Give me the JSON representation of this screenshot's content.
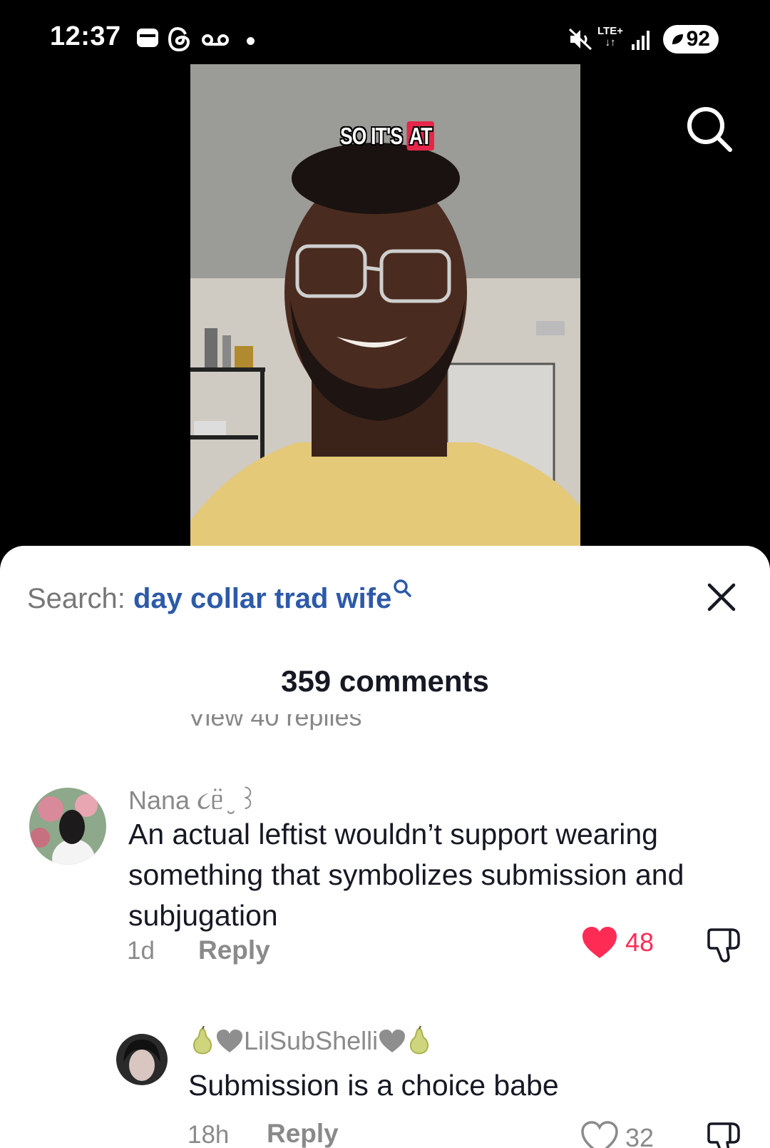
{
  "status_bar": {
    "time": "12:37",
    "icons": [
      "message-icon",
      "threads-icon",
      "voicemail-icon",
      "dot-icon",
      "mute-icon",
      "signal-icon"
    ],
    "network": "LTE+",
    "battery": "92"
  },
  "video": {
    "caption_prefix": "SO IT'S",
    "caption_highlight": "AT",
    "accent_color": "#e5264a"
  },
  "sheet": {
    "search_label": "Search:",
    "search_query": "day collar trad wife",
    "comments_count": "359 comments",
    "view_replies": "View 40 replies"
  },
  "comments": [
    {
      "username": "Nana ૮ᥱ̈ ̮ ꒱",
      "text": "An actual leftist wouldn’t support wearing something that symbolizes submission and subjugation",
      "age": "1d",
      "reply_label": "Reply",
      "likes": "48",
      "liked": true
    },
    {
      "username": "LilSubShelli",
      "text": "Submission is a choice babe",
      "age": "18h",
      "reply_label": "Reply",
      "likes": "32",
      "liked": false
    }
  ],
  "colors": {
    "like_red": "#fe2c55",
    "link_blue": "#2d5aa8"
  }
}
